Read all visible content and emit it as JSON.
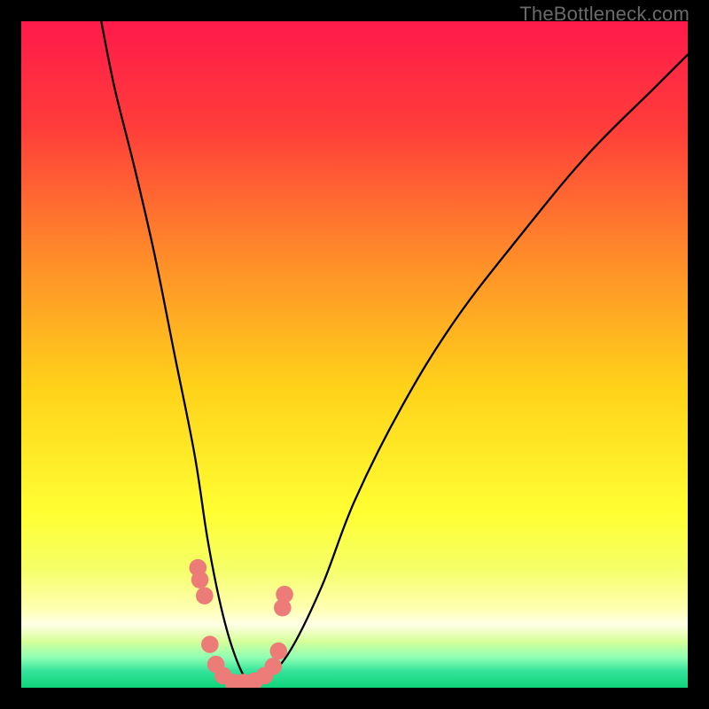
{
  "watermark": "TheBottleneck.com",
  "chart_data": {
    "type": "line",
    "title": "",
    "xlabel": "",
    "ylabel": "",
    "xlim": [
      0,
      100
    ],
    "ylim": [
      0,
      100
    ],
    "grid": false,
    "legend": false,
    "gradient_stops": [
      {
        "offset": 0.0,
        "color": "#ff1a4b"
      },
      {
        "offset": 0.16,
        "color": "#ff3d3a"
      },
      {
        "offset": 0.35,
        "color": "#ff8a2a"
      },
      {
        "offset": 0.55,
        "color": "#ffd21a"
      },
      {
        "offset": 0.74,
        "color": "#ffff33"
      },
      {
        "offset": 0.82,
        "color": "#f5ff66"
      },
      {
        "offset": 0.88,
        "color": "#ffffb0"
      },
      {
        "offset": 0.905,
        "color": "#ffffe6"
      },
      {
        "offset": 0.93,
        "color": "#d7ff9a"
      },
      {
        "offset": 0.955,
        "color": "#8dffb4"
      },
      {
        "offset": 0.975,
        "color": "#34e39a"
      },
      {
        "offset": 1.0,
        "color": "#0fd47a"
      }
    ],
    "series": [
      {
        "name": "bottleneck-curve",
        "x": [
          12,
          14,
          17,
          20,
          23,
          26,
          28,
          30,
          32,
          34,
          36,
          40,
          45,
          50,
          57,
          65,
          75,
          85,
          95,
          100
        ],
        "y": [
          100,
          90,
          78,
          65,
          50,
          35,
          22,
          12,
          5,
          1,
          1,
          5,
          15,
          28,
          42,
          55,
          68,
          80,
          90,
          95
        ]
      }
    ],
    "marker_clusters": [
      {
        "x": 26.5,
        "y": 18.0,
        "r": 1.3
      },
      {
        "x": 26.8,
        "y": 16.2,
        "r": 1.3
      },
      {
        "x": 27.5,
        "y": 13.8,
        "r": 1.3
      },
      {
        "x": 28.3,
        "y": 6.5,
        "r": 1.3
      },
      {
        "x": 29.2,
        "y": 3.5,
        "r": 1.3
      },
      {
        "x": 30.3,
        "y": 1.8,
        "r": 1.3
      },
      {
        "x": 31.8,
        "y": 0.8,
        "r": 1.3
      },
      {
        "x": 33.3,
        "y": 0.8,
        "r": 1.3
      },
      {
        "x": 35.0,
        "y": 1.0,
        "r": 1.3
      },
      {
        "x": 36.5,
        "y": 1.8,
        "r": 1.3
      },
      {
        "x": 37.8,
        "y": 3.2,
        "r": 1.3
      },
      {
        "x": 38.6,
        "y": 5.5,
        "r": 1.3
      },
      {
        "x": 39.2,
        "y": 12.0,
        "r": 1.3
      },
      {
        "x": 39.5,
        "y": 14.0,
        "r": 1.3
      }
    ],
    "marker_color": "#ed7b78"
  }
}
